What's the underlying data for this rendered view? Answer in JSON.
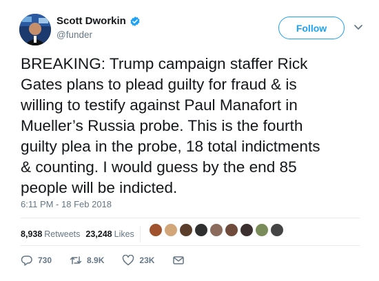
{
  "author": {
    "display_name": "Scott Dworkin",
    "handle": "@funder",
    "verified": true
  },
  "follow_button": {
    "label": "Follow"
  },
  "tweet": {
    "text": "BREAKING: Trump campaign staffer Rick\nGates plans to plead guilty for fraud & is\nwilling to testify against Paul Manafort in\nMueller’s Russia probe. This is the fourth\nguilty plea in the probe, 18 total indictments\n& counting. I would guess by the end 85\npeople will be indicted.",
    "timestamp": "6:11 PM - 18 Feb 2018"
  },
  "stats": {
    "retweets_count": "8,938",
    "retweets_label": "Retweets",
    "likes_count": "23,248",
    "likes_label": "Likes",
    "liker_avatar_colors": [
      "#a0522d",
      "#d2a679",
      "#5a3d2b",
      "#2f2f2f",
      "#8b6c5c",
      "#6e4b3a",
      "#3b2f2f",
      "#7a8c5a",
      "#444444"
    ]
  },
  "actions": {
    "replies": "730",
    "retweets": "8.9K",
    "likes": "23K"
  },
  "colors": {
    "accent": "#1da1f2",
    "secondary_text": "#657786",
    "divider": "#e6ecf0"
  },
  "icons": {
    "verified": "verified-badge-icon",
    "caret": "chevron-down-icon",
    "reply": "reply-icon",
    "retweet": "retweet-icon",
    "like": "heart-icon",
    "dm": "envelope-icon"
  }
}
